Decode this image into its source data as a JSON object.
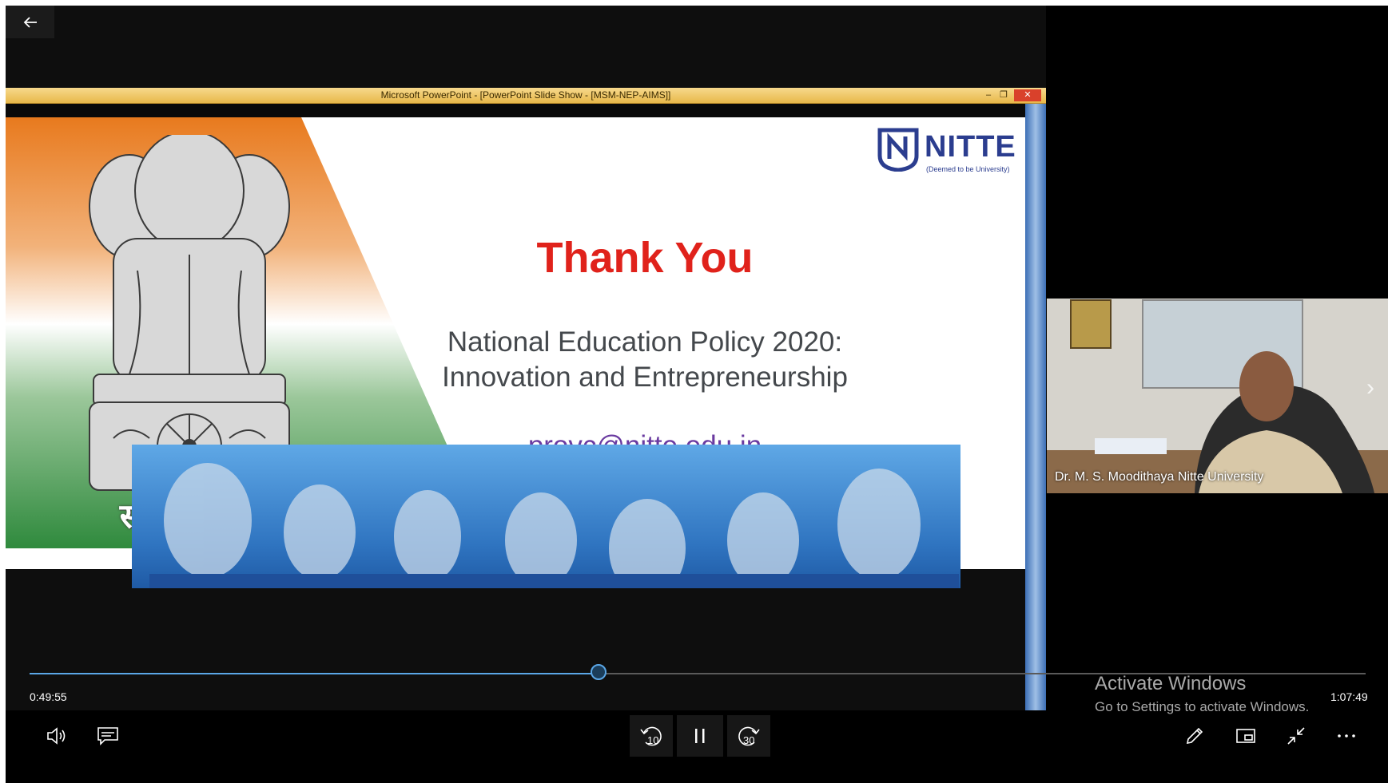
{
  "app": {
    "back_icon": "arrow-left-icon",
    "ppt_window_title": "Microsoft PowerPoint - [PowerPoint Slide Show - [MSM-NEP-AIMS]]",
    "ppt_min": "–",
    "ppt_restore": "❐",
    "ppt_close": "✕"
  },
  "slide": {
    "thank_you": "Thank You",
    "policy_line1": "National Education Policy 2020:",
    "policy_line2": "Innovation and Entrepreneurship",
    "email": "provc@nitte.edu.in",
    "logo_text": "NITTE",
    "logo_subtext": "(Deemed to be University)",
    "motto": "सत्यमेव जयते"
  },
  "participant": {
    "name": "Dr. M. S. Moodithaya Nitte University",
    "next_icon": "chevron-right-icon"
  },
  "playback": {
    "current_time": "0:49:55",
    "total_time": "1:07:49",
    "progress_fraction": 0.426,
    "skip_back_seconds": "10",
    "skip_forward_seconds": "30"
  },
  "watermark": {
    "line1": "Activate Windows",
    "line2": "Go to Settings to activate Windows."
  },
  "colors": {
    "accent": "#5aa6e6",
    "thank_you": "#e0221b",
    "email": "#6a3aa0",
    "nitte_blue": "#2b3d8f"
  }
}
